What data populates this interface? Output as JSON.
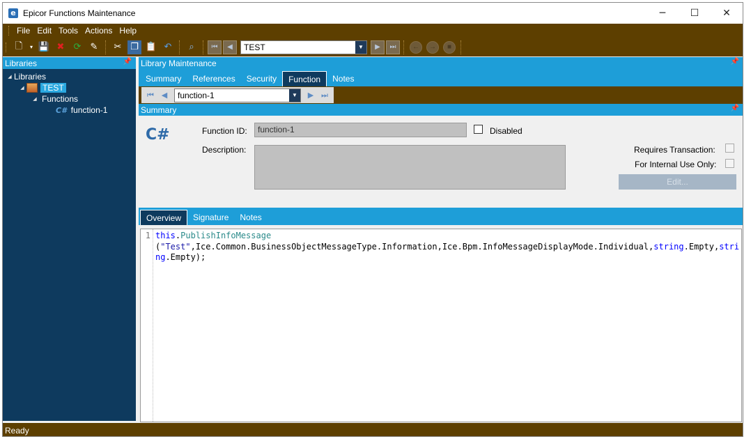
{
  "window": {
    "title": "Epicor Functions Maintenance",
    "app_icon": "e",
    "controls": {
      "minimize": "─",
      "maximize": "☐",
      "close": "✕"
    }
  },
  "menu": {
    "items": [
      "File",
      "Edit",
      "Tools",
      "Actions",
      "Help"
    ]
  },
  "toolbar": {
    "combo_value": "TEST",
    "icons": [
      "new-icon",
      "save-icon",
      "delete-icon",
      "refresh-icon",
      "clear-icon",
      "cut-icon",
      "copy-icon",
      "paste-icon",
      "undo-icon",
      "search-icon"
    ]
  },
  "libraries_panel": {
    "header": "Libraries",
    "tree": {
      "root": "Libraries",
      "library": "TEST",
      "folder": "Functions",
      "cs_label": "C#",
      "function": "function-1"
    }
  },
  "library_panel": {
    "header": "Library Maintenance",
    "tabs": [
      "Summary",
      "References",
      "Security",
      "Function",
      "Notes"
    ],
    "active_tab": "Function",
    "nav_combo_value": "function-1"
  },
  "summary": {
    "header": "Summary",
    "cs_logo": "C#",
    "function_id_label": "Function ID:",
    "function_id_value": "function-1",
    "disabled_label": "Disabled",
    "description_label": "Description:",
    "description_value": "",
    "requires_transaction_label": "Requires Transaction:",
    "internal_use_label": "For Internal Use Only:",
    "edit_button": "Edit..."
  },
  "lower_tabs": {
    "tabs": [
      "Overview",
      "Signature",
      "Notes"
    ],
    "active_tab": "Overview"
  },
  "code": {
    "line_number": "1",
    "tokens": {
      "t1": "this",
      "t2": ".",
      "t3": "PublishInfoMessage",
      "t4": "(",
      "t5": "\"Test\"",
      "t6": ",Ice.Common.BusinessObjectMessageType.Information,Ice.Bpm.InfoMessageDisplayMode.Individual,",
      "t7": "string",
      "t8": ".Empty,",
      "t9": "string",
      "t10": ".Empty);"
    }
  },
  "status": {
    "text": "Ready"
  },
  "colors": {
    "brown": "#5d3f00",
    "blue_header": "#1e9ed8",
    "navy": "#0e3a5e"
  }
}
